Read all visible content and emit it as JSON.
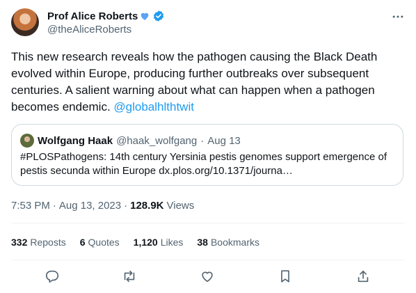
{
  "author": {
    "display_name": "Prof Alice Roberts",
    "handle": "@theAliceRoberts"
  },
  "tweet": {
    "text": "This new research reveals how the pathogen causing the Black Death evolved within Europe, producing further outbreaks over subsequent centuries. A salient warning about what can happen when a pathogen becomes endemic. ",
    "mention": "@globalhlthtwit"
  },
  "quote": {
    "name": "Wolfgang Haak",
    "handle": "@haak_wolfgang",
    "separator": "·",
    "date": "Aug 13",
    "text": "#PLOSPathogens: 14th century Yersinia pestis genomes support emergence of pestis secunda within Europe dx.plos.org/10.1371/journa…"
  },
  "meta": {
    "time": "7:53 PM",
    "separator1": "·",
    "date": "Aug 13, 2023",
    "separator2": "·",
    "views_count": "128.9K",
    "views_label": "Views"
  },
  "stats": {
    "reposts_count": "332",
    "reposts_label": "Reposts",
    "quotes_count": "6",
    "quotes_label": "Quotes",
    "likes_count": "1,120",
    "likes_label": "Likes",
    "bookmarks_count": "38",
    "bookmarks_label": "Bookmarks"
  },
  "colors": {
    "accent": "#1d9bf0",
    "heart": "#5ba3f5",
    "text": "#0f1419",
    "muted": "#536471"
  },
  "icons": [
    "blue-heart-icon",
    "verified-icon",
    "more-icon",
    "reply-icon",
    "repost-icon",
    "like-icon",
    "bookmark-icon",
    "share-icon"
  ]
}
